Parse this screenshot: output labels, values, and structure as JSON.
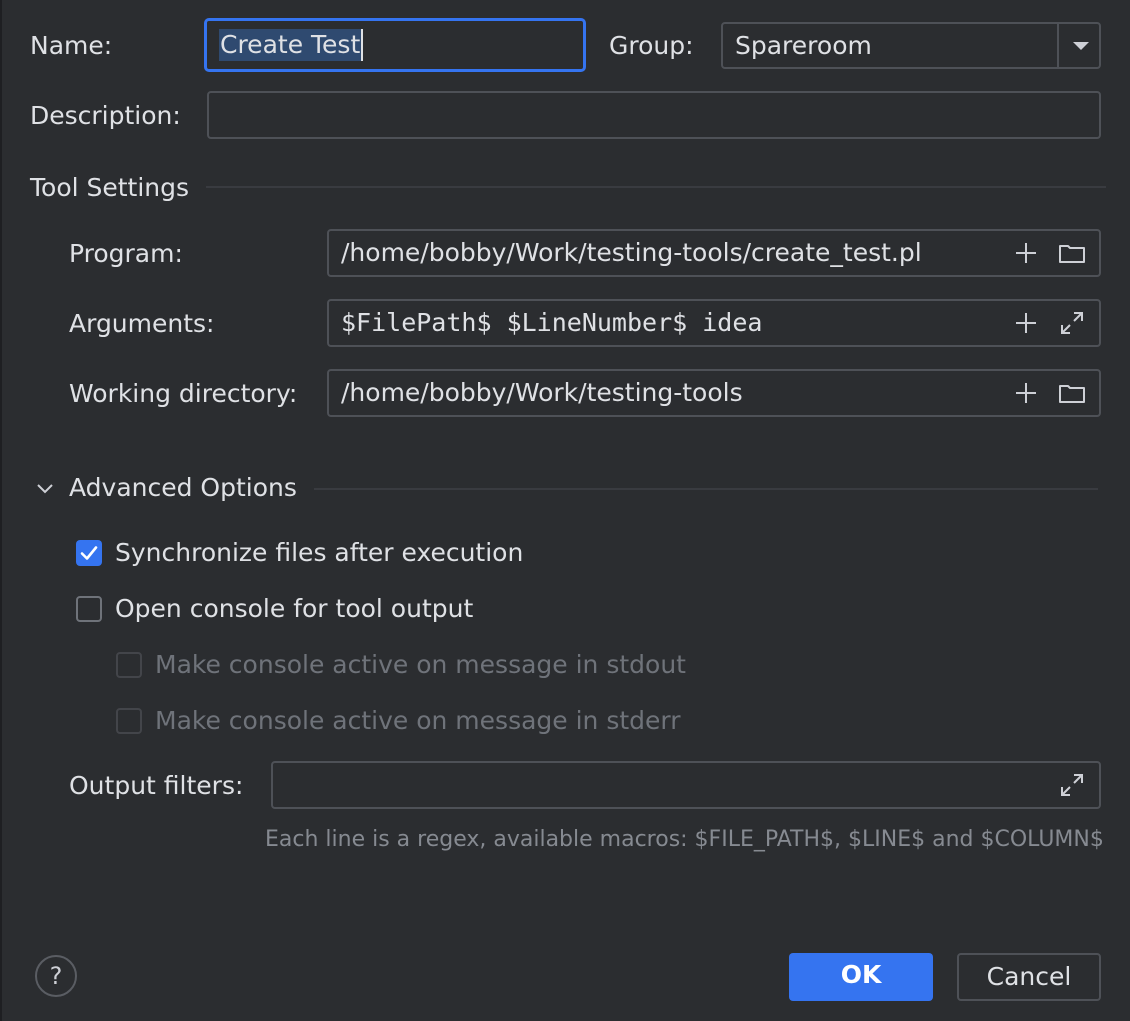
{
  "name": {
    "label": "Name:",
    "value": "Create Test"
  },
  "group": {
    "label": "Group:",
    "value": "Spareroom"
  },
  "description": {
    "label": "Description:",
    "value": ""
  },
  "tool_settings": {
    "title": "Tool Settings",
    "program": {
      "label": "Program:",
      "value": "/home/bobby/Work/testing-tools/create_test.pl"
    },
    "arguments": {
      "label": "Arguments:",
      "value": "$FilePath$ $LineNumber$ idea"
    },
    "working_directory": {
      "label": "Working directory:",
      "value": "/home/bobby/Work/testing-tools"
    }
  },
  "advanced": {
    "title": "Advanced Options",
    "sync_files": {
      "label": "Synchronize files after execution",
      "checked": true
    },
    "open_console": {
      "label": "Open console for tool output",
      "checked": false
    },
    "console_stdout": {
      "label": "Make console active on message in stdout",
      "checked": false,
      "enabled": false
    },
    "console_stderr": {
      "label": "Make console active on message in stderr",
      "checked": false,
      "enabled": false
    },
    "output_filters": {
      "label": "Output filters:",
      "value": ""
    },
    "hint": "Each line is a regex, available macros: $FILE_PATH$, $LINE$ and $COLUMN$"
  },
  "buttons": {
    "help": "?",
    "ok": "OK",
    "cancel": "Cancel"
  },
  "colors": {
    "accent": "#3574f0",
    "background": "#2b2d30",
    "border": "#4e5157",
    "focus": "#3574f0"
  }
}
